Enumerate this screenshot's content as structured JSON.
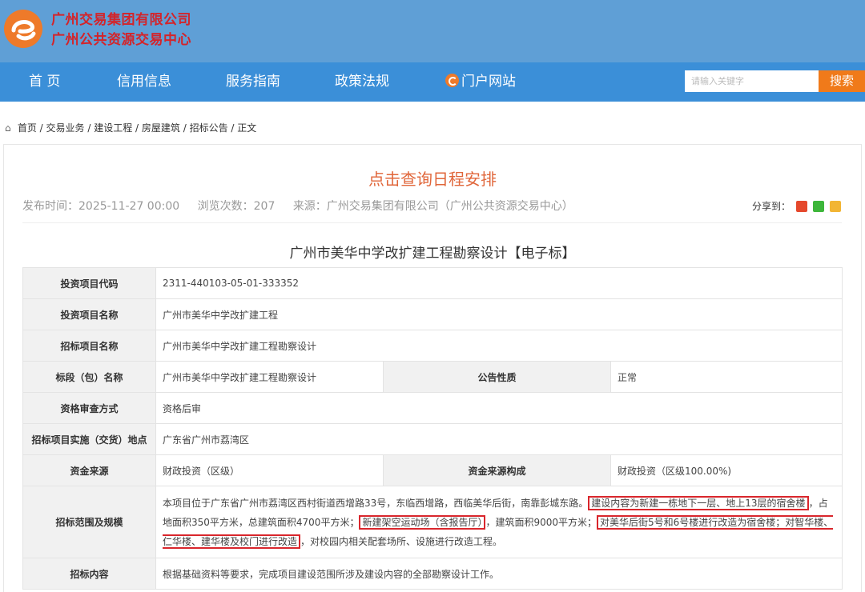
{
  "header": {
    "org_line1": "广州交易集团有限公司",
    "org_line2": "广州公共资源交易中心"
  },
  "nav": {
    "items": [
      "首 页",
      "信用信息",
      "服务指南",
      "政策法规",
      "门户网站"
    ],
    "search_placeholder": "请输入关键字",
    "search_button": "搜索"
  },
  "breadcrumb": [
    "首页",
    "交易业务",
    "建设工程",
    "房屋建筑",
    "招标公告",
    "正文"
  ],
  "breadcrumb_sep": " / ",
  "article": {
    "link_title": "点击查询日程安排",
    "publish_time": "发布时间：2025-11-27 00:00",
    "views": "浏览次数：207",
    "source": "来源：广州交易集团有限公司（广州公共资源交易中心）",
    "share_label": "分享到：",
    "title": "广州市美华中学改扩建工程勘察设计【电子标】"
  },
  "table": {
    "rows": [
      {
        "key": "投资项目代码",
        "value": "2311-440103-05-01-333352"
      },
      {
        "key": "投资项目名称",
        "value": "广州市美华中学改扩建工程"
      },
      {
        "key": "招标项目名称",
        "value": "广州市美华中学改扩建工程勘察设计"
      },
      {
        "key": "标段（包）名称",
        "value": "广州市美华中学改扩建工程勘察设计",
        "key2": "公告性质",
        "value2": "正常"
      },
      {
        "key": "资格审查方式",
        "value": "资格后审"
      },
      {
        "key": "招标项目实施（交货）地点",
        "value": "广东省广州市荔湾区"
      },
      {
        "key": "资金来源",
        "value": "财政投资（区级）",
        "key2": "资金来源构成",
        "value2": "财政投资（区级100.00%)"
      },
      {
        "key": "招标范围及规模",
        "p1": "本项目位于广东省广州市荔湾区西村街道西增路33号，东临西增路，西临美华后街，南靠彭城东路。",
        "h1": "建设内容为新建一栋地下一层、地上13层的宿舍楼",
        "p2": "，占地面积350平方米，总建筑面积4700平方米；",
        "h2": "新建架空运动场（含报告厅）",
        "p3": "，建筑面积9000平方米；",
        "h3": "对美华后街5号和6号楼进行改造为宿舍楼；对智华楼、仁华楼、建华楼及校门进行改造",
        "p4": "，对校园内相关配套场所、设施进行改造工程。"
      },
      {
        "key": "招标内容",
        "value": "根据基础资料等要求，完成项目建设范围所涉及建设内容的全部勘察设计工作。"
      }
    ]
  }
}
